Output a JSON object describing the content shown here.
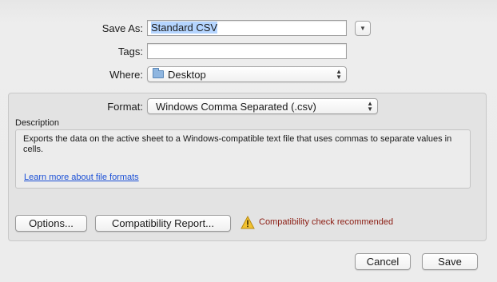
{
  "save_as": {
    "label": "Save As:",
    "value": "Standard CSV"
  },
  "tags": {
    "label": "Tags:",
    "value": ""
  },
  "where": {
    "label": "Where:",
    "value": "Desktop",
    "icon": "folder-icon"
  },
  "format": {
    "label": "Format:",
    "value": "Windows Comma Separated (.csv)"
  },
  "description": {
    "title": "Description",
    "text": "Exports the data on the active sheet to a Windows-compatible text file that uses commas to separate values in cells.",
    "link": "Learn more about file formats"
  },
  "buttons": {
    "options": "Options...",
    "compat_report": "Compatibility Report...",
    "cancel": "Cancel",
    "save": "Save"
  },
  "warning": {
    "text": "Compatibility check recommended",
    "icon": "warning-icon",
    "color": "#8b1c12"
  },
  "colors": {
    "link": "#1a4fd6",
    "folder": "#8fb6e0"
  }
}
